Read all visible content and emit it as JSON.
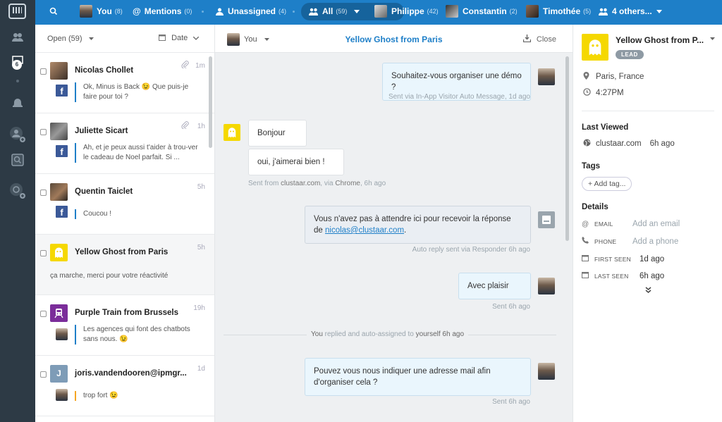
{
  "topbar": {
    "you_label": "You",
    "you_count": "(8)",
    "mentions_label": "Mentions",
    "mentions_count": "(0)",
    "unassigned_label": "Unassigned",
    "unassigned_count": "(4)",
    "all_label": "All",
    "all_count": "(59)",
    "philippe_label": "Philippe",
    "philippe_count": "(42)",
    "constantin_label": "Constantin",
    "constantin_count": "(2)",
    "timothee_label": "Timothée",
    "timothee_count": "(5)",
    "others_label": "4 others..."
  },
  "rail": {
    "badge": "6"
  },
  "list": {
    "filter_label": "Open (59)",
    "sort_label": "Date",
    "conversations": [
      {
        "name": "Nicolas Chollet",
        "time": "1m",
        "preview": "Ok, Minus is Back 😉 Que puis-je faire pour toi ?",
        "channel": "facebook"
      },
      {
        "name": "Juliette Sicart",
        "time": "1h",
        "preview": "Ah, et je peux aussi t'aider à trou-ver le cadeau de Noel parfait. Si ...",
        "channel": "facebook"
      },
      {
        "name": "Quentin Taiclet",
        "time": "5h",
        "preview": "Coucou !",
        "channel": "facebook"
      },
      {
        "name": "Yellow Ghost from Paris",
        "time": "5h",
        "preview": "ça marche, merci pour votre réactivité",
        "channel": "web"
      },
      {
        "name": "Purple Train from Brussels",
        "time": "19h",
        "preview": "Les agences qui font des chatbots sans nous. 😉",
        "channel": "web"
      },
      {
        "name": "joris.vandendooren@ipmgr...",
        "time": "1d",
        "avatar_letter": "J",
        "preview": "trop fort 😉",
        "channel": "web"
      }
    ]
  },
  "chat": {
    "assignee": "You",
    "title": "Yellow Ghost from Paris",
    "close_label": "Close",
    "messages": [
      {
        "text": "Souhaitez-vous organiser une démo ?",
        "meta": "Sent via In-App Visitor Auto Message, 1d ago"
      },
      {
        "text": "Bonjour"
      },
      {
        "text": "oui, j'aimerai bien !",
        "meta_prefix": "Sent from ",
        "meta_site": "clustaar.com",
        "meta_mid": ", via ",
        "meta_browser": "Chrome",
        "meta_time": ", 6h ago"
      },
      {
        "text": "Vous n'avez pas à attendre ici pour recevoir la réponse de",
        "email": "nicolas@clustaar.com",
        "email_suffix": ".",
        "meta": "Auto reply sent via Responder 6h ago"
      },
      {
        "text": "Avec plaisir",
        "meta": "Sent 6h ago"
      },
      {
        "text": "Pouvez vous nous indiquer une adresse mail afin d'organiser cela ?",
        "meta": "Sent 6h ago"
      }
    ],
    "system": {
      "you": "You",
      "mid": " replied and auto-assigned to ",
      "target": "yourself",
      "time": " 6h ago"
    }
  },
  "panel": {
    "name": "Yellow Ghost from P...",
    "badge": "LEAD",
    "location": "Paris, France",
    "local_time": "4:27PM",
    "last_viewed_title": "Last Viewed",
    "last_viewed_site": "clustaar.com",
    "last_viewed_time": "6h ago",
    "tags_title": "Tags",
    "add_tag": "+ Add tag...",
    "details_title": "Details",
    "details": [
      {
        "label": "EMAIL",
        "value": "Add an email",
        "placeholder": true
      },
      {
        "label": "PHONE",
        "value": "Add a phone",
        "placeholder": true
      },
      {
        "label": "FIRST SEEN",
        "value": "1d ago"
      },
      {
        "label": "LAST SEEN",
        "value": "6h ago"
      }
    ]
  },
  "colors": {
    "topbar": "#1e7fc8",
    "rail": "#2d3a45",
    "accent": "#1e7fc8",
    "lead_badge": "#8e9aa4",
    "ghost": "#f5d800",
    "facebook": "#3b5998"
  },
  "icons": [
    "intercom-logo",
    "people-icon",
    "chat-icon",
    "bell-icon",
    "add-user-icon",
    "search-box-icon",
    "search-icon",
    "mention-icon",
    "user-icon",
    "group-icon",
    "calendar-icon",
    "paperclip-icon",
    "facebook-icon",
    "download-icon",
    "pin-icon",
    "clock-icon",
    "globe-icon",
    "email-icon",
    "phone-icon",
    "double-chevron-down-icon"
  ]
}
